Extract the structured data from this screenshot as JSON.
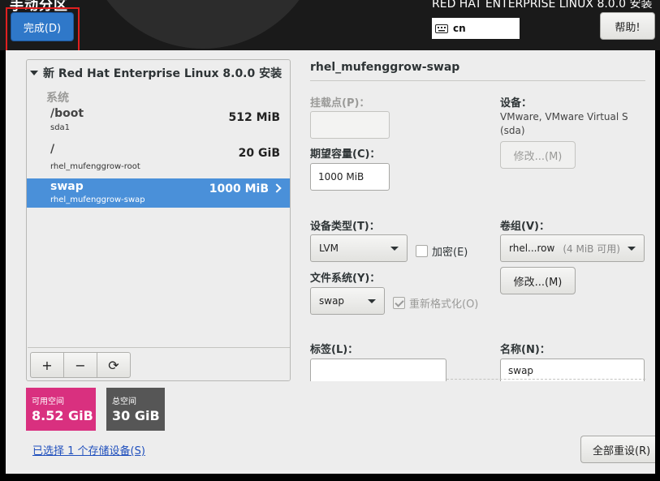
{
  "header": {
    "page_title": "手动分区",
    "done_label": "完成(D)",
    "product_title": "RED HAT ENTERPRISE LINUX 8.0.0 安装",
    "keyboard_layout": "cn",
    "help_label": "帮助!"
  },
  "partition_list": {
    "heading": "新 Red Hat Enterprise Linux 8.0.0 安装",
    "group_label": "系统",
    "rows": [
      {
        "mount": "/boot",
        "device": "sda1",
        "size": "512 MiB",
        "selected": false
      },
      {
        "mount": "/",
        "device": "rhel_mufenggrow-root",
        "size": "20 GiB",
        "selected": false
      },
      {
        "mount": "swap",
        "device": "rhel_mufenggrow-swap",
        "size": "1000 MiB",
        "selected": true
      }
    ],
    "toolbar": {
      "add": "+",
      "remove": "−",
      "refresh": "⟳"
    }
  },
  "space": {
    "available_label": "可用空间",
    "available_value": "8.52 GiB",
    "total_label": "总空间",
    "total_value": "30 GiB"
  },
  "storage_link": "已选择 1 个存储设备(S)",
  "reset_label": "全部重设(R)",
  "detail": {
    "title": "rhel_mufenggrow-swap",
    "mount_point_label": "挂载点(P)：",
    "mount_point_value": "",
    "desired_capacity_label": "期望容量(C)：",
    "desired_capacity_value": "1000 MiB",
    "device_label": "设备：",
    "device_info_line1": "VMware, VMware Virtual S",
    "device_info_line2": "(sda)",
    "device_modify_label": "修改...(M)",
    "device_type_label": "设备类型(T)：",
    "device_type_value": "LVM",
    "encrypt_label": "加密(E)",
    "volume_group_label": "卷组(V)：",
    "volume_group_value": "rhel...row",
    "volume_group_free": "(4 MiB 可用)",
    "volume_group_modify_label": "修改...(M)",
    "filesystem_label": "文件系统(Y)：",
    "filesystem_value": "swap",
    "reformat_label": "重新格式化(O)",
    "tag_label": "标签(L)：",
    "tag_value": "",
    "name_label": "名称(N)：",
    "name_value": "swap"
  },
  "colors": {
    "accent": "#2f78c9",
    "selection": "#4a90d9",
    "available": "#d9307f",
    "total": "#565656"
  }
}
